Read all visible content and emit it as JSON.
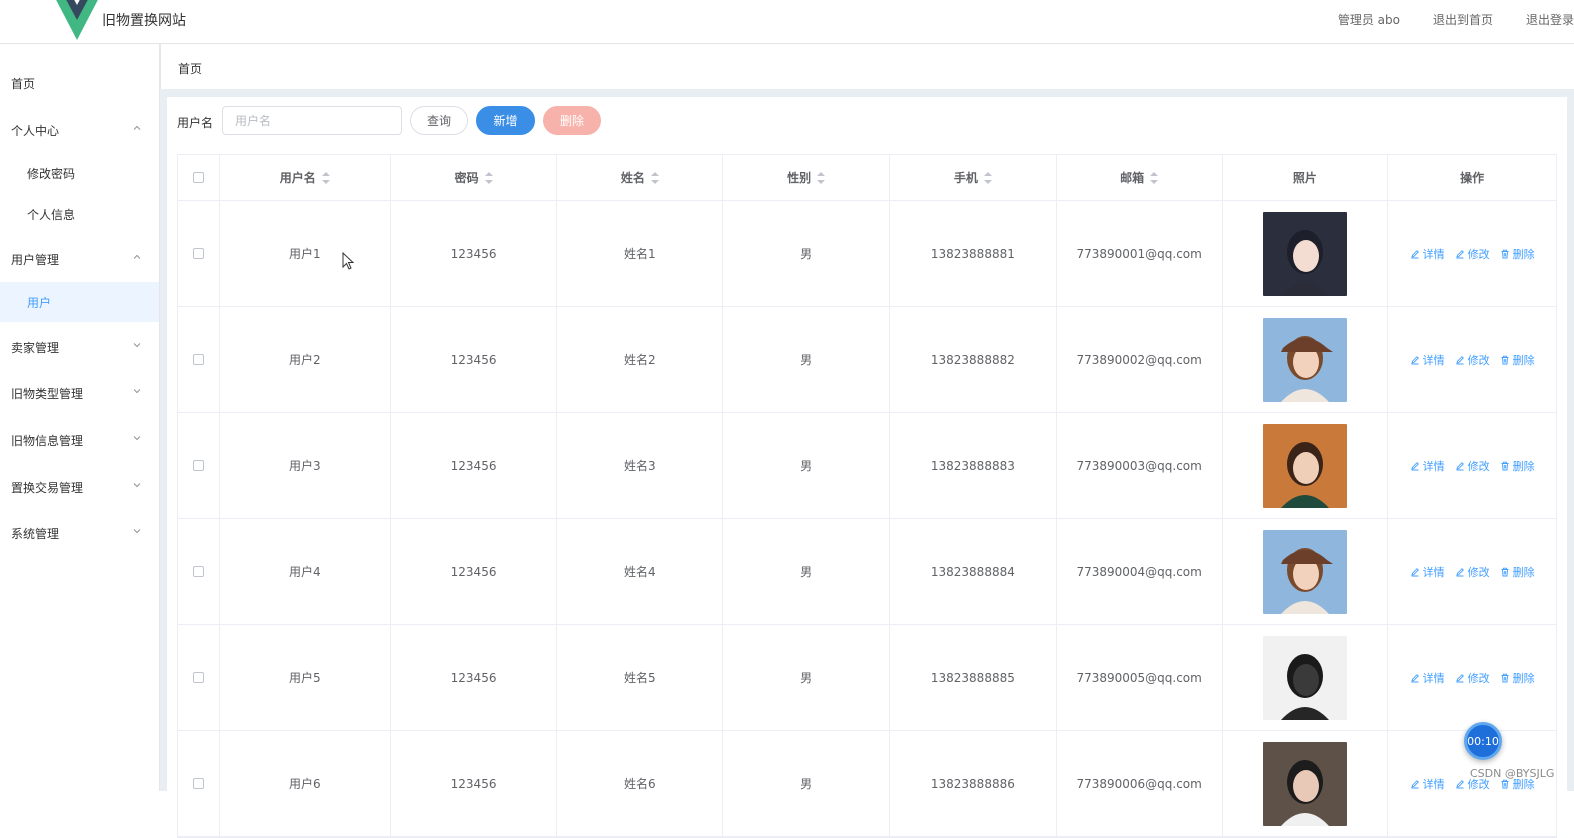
{
  "header": {
    "site_title": "旧物置换网站",
    "admin_label": "管理员 abo",
    "exit_home": "退出到首页",
    "logout": "退出登录"
  },
  "sidebar": {
    "items": [
      {
        "label": "首页",
        "level": 1
      },
      {
        "label": "个人中心",
        "level": 1,
        "expanded": true
      },
      {
        "label": "修改密码",
        "level": 2
      },
      {
        "label": "个人信息",
        "level": 2
      },
      {
        "label": "用户管理",
        "level": 1,
        "expanded": true
      },
      {
        "label": "用户",
        "level": 2,
        "active": true
      },
      {
        "label": "卖家管理",
        "level": 1
      },
      {
        "label": "旧物类型管理",
        "level": 1
      },
      {
        "label": "旧物信息管理",
        "level": 1
      },
      {
        "label": "置换交易管理",
        "level": 1
      },
      {
        "label": "系统管理",
        "level": 1
      }
    ]
  },
  "breadcrumb": "首页",
  "search": {
    "label": "用户名",
    "placeholder": "用户名",
    "query_label": "查询",
    "add_label": "新增",
    "delete_label": "删除"
  },
  "table": {
    "columns": [
      "用户名",
      "密码",
      "姓名",
      "性别",
      "手机",
      "邮箱",
      "照片",
      "操作"
    ],
    "rows": [
      {
        "username": "用户1",
        "password": "123456",
        "name": "姓名1",
        "gender": "男",
        "phone": "13823888881",
        "email": "773890001@qq.com"
      },
      {
        "username": "用户2",
        "password": "123456",
        "name": "姓名2",
        "gender": "男",
        "phone": "13823888882",
        "email": "773890002@qq.com"
      },
      {
        "username": "用户3",
        "password": "123456",
        "name": "姓名3",
        "gender": "男",
        "phone": "13823888883",
        "email": "773890003@qq.com"
      },
      {
        "username": "用户4",
        "password": "123456",
        "name": "姓名4",
        "gender": "男",
        "phone": "13823888884",
        "email": "773890004@qq.com"
      },
      {
        "username": "用户5",
        "password": "123456",
        "name": "姓名5",
        "gender": "男",
        "phone": "13823888885",
        "email": "773890005@qq.com"
      },
      {
        "username": "用户6",
        "password": "123456",
        "name": "姓名6",
        "gender": "男",
        "phone": "13823888886",
        "email": "773890006@qq.com"
      }
    ],
    "ops": {
      "detail": "详情",
      "edit": "修改",
      "delete": "删除"
    }
  },
  "timer": "00:10",
  "watermark": "CSDN @BYSJLG",
  "colors": {
    "primary": "#409eff",
    "danger_light": "#f7b3ab",
    "brand_green": "#41b883",
    "brand_dark": "#35495e"
  }
}
